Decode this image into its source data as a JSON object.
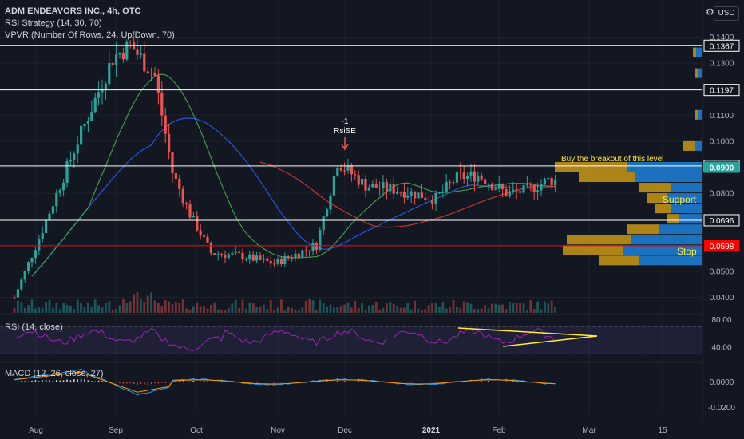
{
  "header": {
    "title": "ADM ENDEAVORS INC., 4h, OTC",
    "strategy_legend": "RSI Strategy (14, 30, 70)",
    "vpvr_legend": "VPVR (Number Of Rows, 24, Up/Down, 70)",
    "rsi_legend": "RSI (14, close)",
    "macd_legend": "MACD (12, 26, close, 27)",
    "currency": "USD"
  },
  "colors": {
    "background": "#131722",
    "up": "#26a69a",
    "down": "#ef5350",
    "level_line": "#ffffff",
    "stop_line": "#ff0000",
    "annotation_text": "#ffeb3b",
    "sma_long": "#2962ff",
    "sma_short": "#4caf50",
    "sma_red": "#e53935",
    "rsi_line": "#9c27b0",
    "vpvr_up": "#1e88e5",
    "vpvr_down": "#d4a017"
  },
  "chart_data": [
    {
      "type": "candlestick",
      "panel": "price",
      "x_ticks": [
        "Aug",
        "Sep",
        "Oct",
        "Nov",
        "Dec",
        "2021",
        "Feb",
        "Mar",
        "15"
      ],
      "y_ticks": [
        "0.1400",
        "0.1300",
        "0.1100",
        "0.1000",
        "0.0800",
        "0.0500",
        "0.0400"
      ],
      "ylim": [
        0.034,
        0.142
      ],
      "series_hints": [
        {
          "x": 0,
          "y": 0.04
        },
        {
          "x": 8,
          "y": 0.066
        },
        {
          "x": 18,
          "y": 0.1
        },
        {
          "x": 28,
          "y": 0.132
        },
        {
          "x": 33,
          "y": 0.137
        },
        {
          "x": 40,
          "y": 0.125
        },
        {
          "x": 45,
          "y": 0.088
        },
        {
          "x": 50,
          "y": 0.072
        },
        {
          "x": 56,
          "y": 0.057
        },
        {
          "x": 64,
          "y": 0.056
        },
        {
          "x": 74,
          "y": 0.053
        },
        {
          "x": 86,
          "y": 0.06
        },
        {
          "x": 92,
          "y": 0.092
        },
        {
          "x": 100,
          "y": 0.083
        },
        {
          "x": 110,
          "y": 0.081
        },
        {
          "x": 120,
          "y": 0.078
        },
        {
          "x": 126,
          "y": 0.086
        },
        {
          "x": 132,
          "y": 0.087
        },
        {
          "x": 140,
          "y": 0.08
        },
        {
          "x": 146,
          "y": 0.081
        },
        {
          "x": 152,
          "y": 0.085
        }
      ],
      "levels": [
        {
          "value": 0.1367,
          "label": "0.1367",
          "color": "#ffffff"
        },
        {
          "value": 0.1197,
          "label": "0.1197",
          "color": "#ffffff"
        },
        {
          "value": 0.0905,
          "label": "0.0905",
          "color": "#ffffff"
        },
        {
          "value": 0.0696,
          "label": "0.0696",
          "color": "#ffffff"
        },
        {
          "value": 0.0598,
          "label": "0.0598",
          "color": "#ff0000"
        }
      ],
      "last_price": {
        "value": 0.09,
        "label": "0.0900"
      },
      "annotations": [
        {
          "text": "Buy the breakout of this level",
          "color": "#ffeb3b"
        },
        {
          "text": "Support",
          "color": "#ffeb3b"
        },
        {
          "text": "Stop",
          "color": "#ffeb3b"
        },
        {
          "text": "-1",
          "color": "#ffffff"
        },
        {
          "text": "RsiSE",
          "color": "#ffffff"
        }
      ]
    },
    {
      "type": "line",
      "panel": "rsi",
      "y_ticks": [
        "80.00",
        "40.00"
      ],
      "bands": [
        70,
        30
      ],
      "ylim": [
        20,
        85
      ]
    },
    {
      "type": "histogram",
      "panel": "macd",
      "y_ticks": [
        "0.0000",
        "-0.0200"
      ],
      "ylim": [
        -0.026,
        0.014
      ]
    }
  ]
}
